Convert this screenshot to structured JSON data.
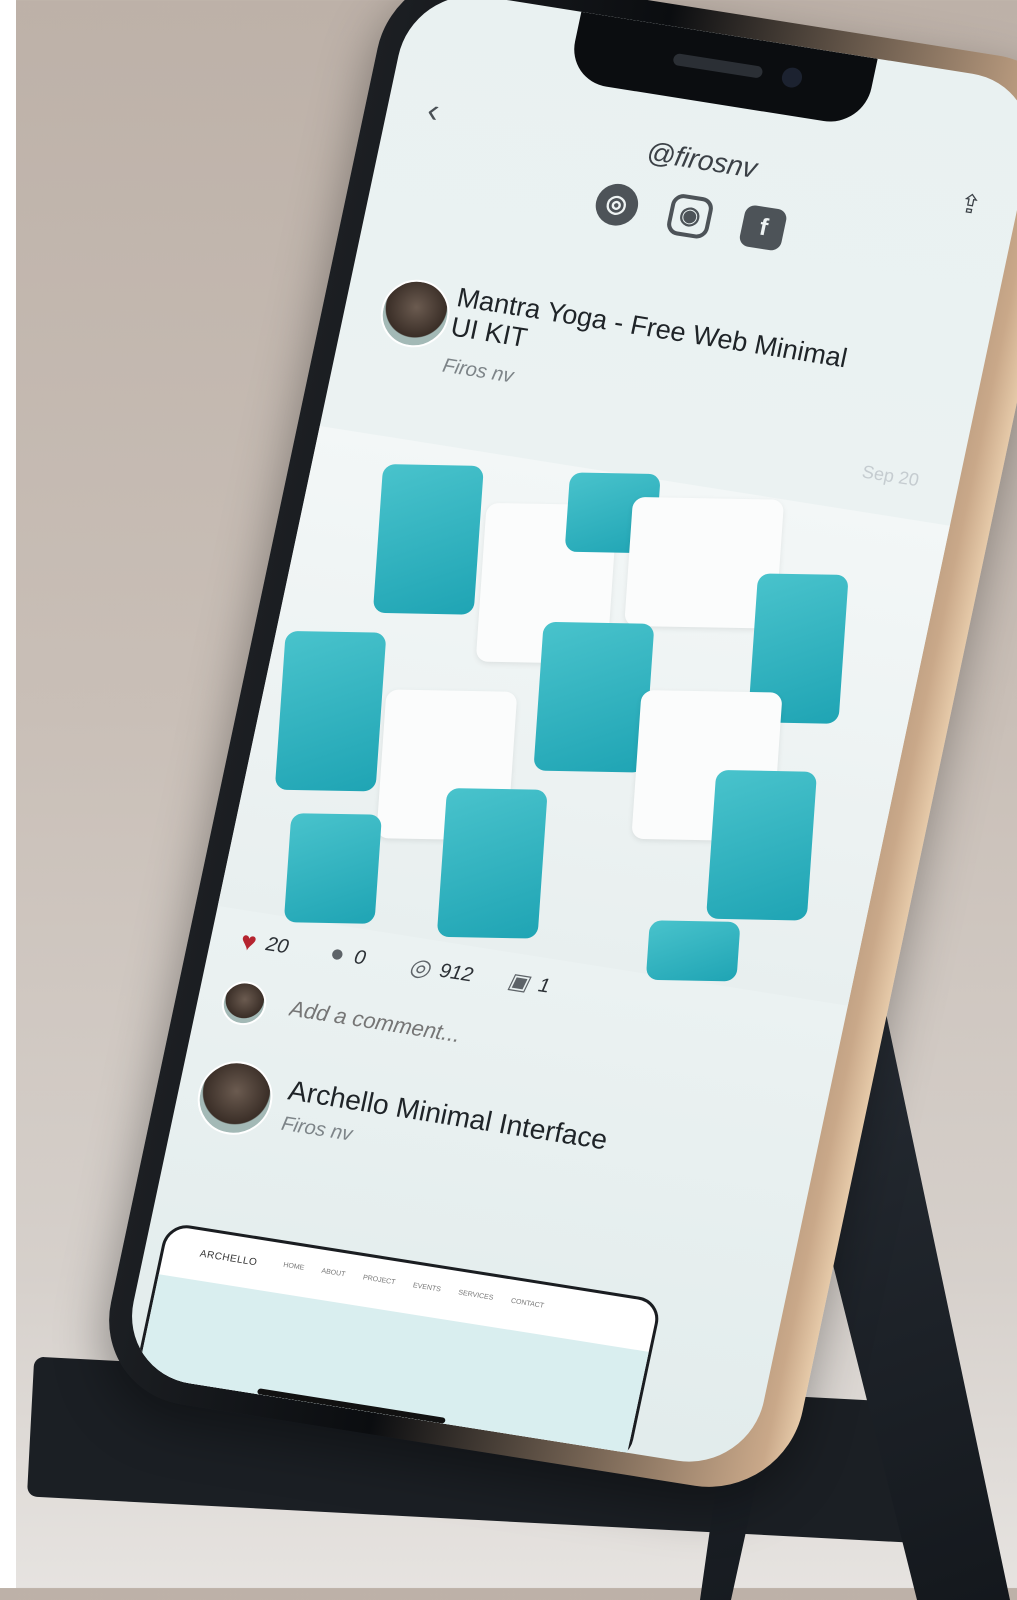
{
  "header": {
    "back_icon": "chevron-left-icon",
    "handle": "@firosnv",
    "share_icon": "share-icon",
    "social_icons": [
      "dribbble-icon",
      "instagram-icon",
      "facebook-icon"
    ]
  },
  "post1": {
    "title": "Mantra Yoga - Free Web Minimal UI KIT",
    "author": "Firos nv",
    "date": "Sep 20"
  },
  "stats": {
    "likes": "20",
    "comments": "0",
    "views": "912",
    "buckets": "1"
  },
  "comment": {
    "placeholder": "Add a comment..."
  },
  "post2": {
    "title": "Archello Minimal Interface",
    "author": "Firos nv"
  },
  "preview": {
    "logo": "ARCHELLO",
    "nav": [
      "HOME",
      "ABOUT",
      "PROJECT",
      "EVENTS",
      "SERVICES",
      "CONTACT"
    ]
  },
  "colors": {
    "accent": "#1fa4b4",
    "like": "#b5242f"
  }
}
